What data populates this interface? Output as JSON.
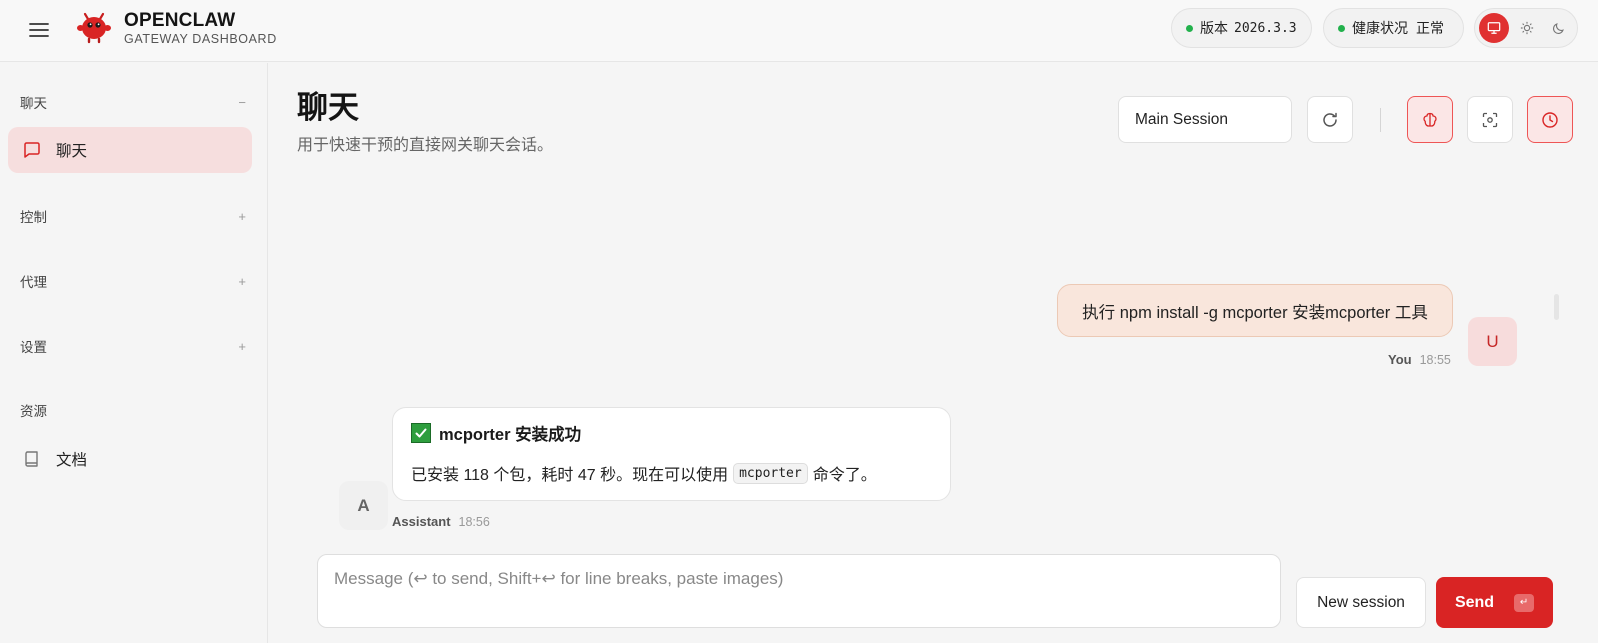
{
  "header": {
    "brand_title": "OPENCLAW",
    "brand_subtitle": "GATEWAY DASHBOARD",
    "version_label": "版本",
    "version_value": "2026.3.3",
    "health_label": "健康状况",
    "health_value": "正常",
    "status_color": "#22b14c",
    "accent_color": "#d92424"
  },
  "sidebar": {
    "sections": [
      {
        "label": "聊天",
        "toggle": "−"
      },
      {
        "label": "控制",
        "toggle": "+"
      },
      {
        "label": "代理",
        "toggle": "+"
      },
      {
        "label": "设置",
        "toggle": "+"
      },
      {
        "label": "资源",
        "toggle": ""
      }
    ],
    "items": [
      {
        "label": "聊天",
        "icon": "chat-bubble-icon",
        "active": true
      },
      {
        "label": "文档",
        "icon": "book-icon",
        "active": false
      }
    ]
  },
  "main": {
    "title": "聊天",
    "subtitle": "用于快速干预的直接网关聊天会话。",
    "session_select_value": "Main Session"
  },
  "messages": [
    {
      "role": "user",
      "avatar": "U",
      "author": "You",
      "time": "18:55",
      "text": "执行 npm install -g mcporter 安装mcporter 工具"
    },
    {
      "role": "assistant",
      "avatar": "A",
      "author": "Assistant",
      "time": "18:56",
      "title": "mcporter 安装成功",
      "body_before": "已安装 118 个包，耗时 47 秒。现在可以使用",
      "code": "mcporter",
      "body_after": "命令了。"
    }
  ],
  "composer": {
    "placeholder": "Message (↩ to send, Shift+↩ for line breaks, paste images)",
    "new_session_label": "New session",
    "send_label": "Send",
    "send_shortcut": "↵"
  }
}
